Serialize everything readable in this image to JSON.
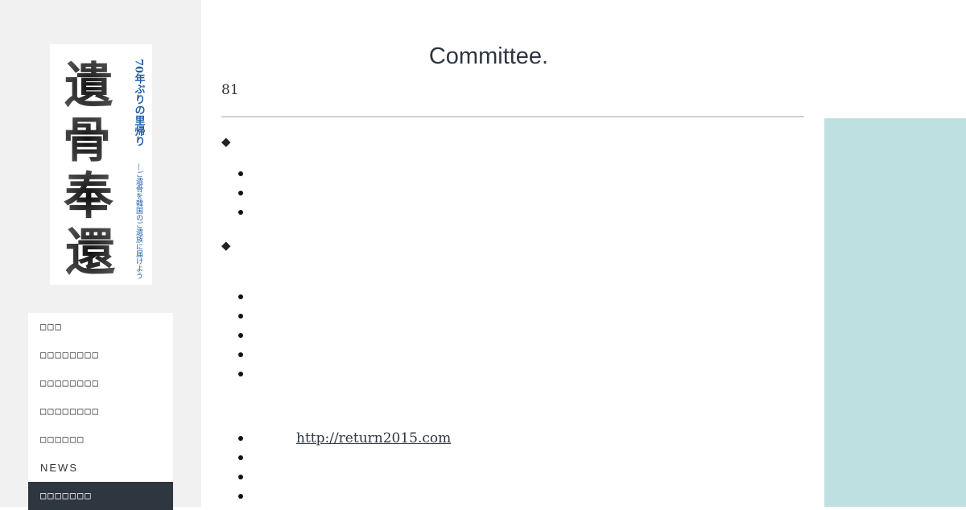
{
  "sidebar": {
    "logo": {
      "alt": "遺骨奉還",
      "main_text": "遺骨奉還",
      "sub_line_1": "70年ぶりの里帰り",
      "sub_line_2": "—ご遺骨を韓国のご遺族に届けよう"
    },
    "nav": [
      {
        "label": "□□□",
        "active": false
      },
      {
        "label": "□□□□□□□□",
        "active": false
      },
      {
        "label": "□□□□□□□□",
        "active": false
      },
      {
        "label": "□□□□□□□□",
        "active": false
      },
      {
        "label": "□□□□□□",
        "active": false
      },
      {
        "label": "NEWS",
        "active": false
      },
      {
        "label": "□□□□□□□",
        "active": true
      }
    ]
  },
  "main": {
    "title": "Committee.",
    "meta": "81",
    "sections": [
      {
        "marker": "◆",
        "bullets": 3
      },
      {
        "marker": "◆",
        "bullets": 5
      }
    ],
    "link": "http://return2015.com"
  },
  "colors": {
    "sidebar_bg": "#f1f1f1",
    "nav_active_bg": "#2e3640",
    "title": "#2e3640",
    "panel": "#bfe0e1",
    "logo_blue": "#1f5fa8"
  }
}
